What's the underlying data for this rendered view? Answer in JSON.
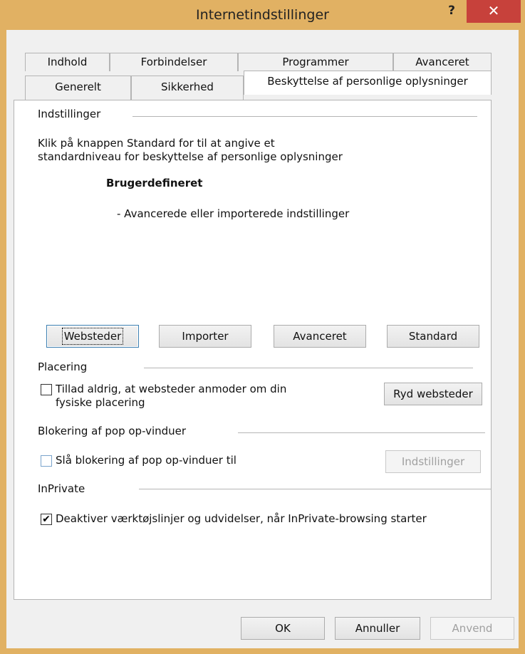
{
  "window": {
    "title": "Internetindstillinger",
    "help": "?",
    "close": "✕"
  },
  "tabs": {
    "row1": [
      "Indhold",
      "Forbindelser",
      "Programmer",
      "Avanceret"
    ],
    "row2": [
      "Generelt",
      "Sikkerhed",
      "Beskyttelse af personlige oplysninger"
    ],
    "active": "Beskyttelse af personlige oplysninger"
  },
  "settings": {
    "group_label": "Indstillinger",
    "description_line1": "Klik på knappen Standard for til at angive et",
    "description_line2": "standardniveau for beskyttelse af personlige oplysninger",
    "level_title": "Brugerdefineret",
    "level_desc": "- Avancerede eller importerede indstillinger",
    "buttons": {
      "websites": "Websteder",
      "import": "Importer",
      "advanced": "Avanceret",
      "default": "Standard"
    }
  },
  "location": {
    "group_label": "Placering",
    "checkbox_line1": "Tillad aldrig, at websteder anmoder om din",
    "checkbox_line2": "fysiske placering",
    "checked": false,
    "clear_button": "Ryd websteder"
  },
  "popup": {
    "group_label": "Blokering af pop op-vinduer",
    "checkbox_label": "Slå blokering af pop op-vinduer til",
    "checked": false,
    "settings_button": "Indstillinger"
  },
  "inprivate": {
    "group_label": "InPrivate",
    "checkbox_label": "Deaktiver værktøjslinjer og udvidelser, når InPrivate-browsing starter",
    "checked": true
  },
  "footer": {
    "ok": "OK",
    "cancel": "Annuller",
    "apply": "Anvend"
  },
  "colors": {
    "frame": "#e1b163",
    "close_button": "#c7413b",
    "focus_border": "#3c7fb1"
  }
}
